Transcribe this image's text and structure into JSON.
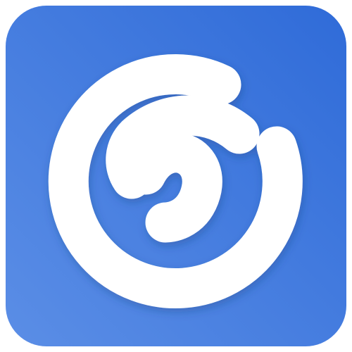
{
  "icon": {
    "name": "spiral-swirl-icon",
    "colors": {
      "tile_light": "#5b8ee6",
      "tile_dark": "#2f6bd8",
      "mark": "#ffffff",
      "shadow": "#1e3f80"
    }
  }
}
